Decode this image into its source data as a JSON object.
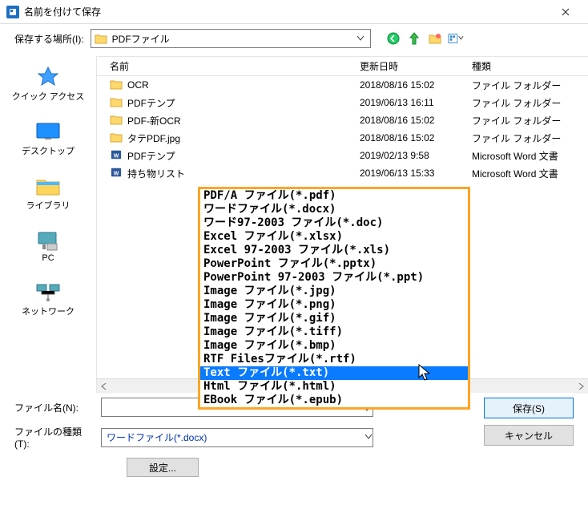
{
  "title": "名前を付けて保存",
  "location": {
    "label": "保存する場所(I):",
    "value": "PDFファイル"
  },
  "sidebar": {
    "items": [
      {
        "label": "クイック アクセス",
        "key": "quick-access"
      },
      {
        "label": "デスクトップ",
        "key": "desktop"
      },
      {
        "label": "ライブラリ",
        "key": "libraries"
      },
      {
        "label": "PC",
        "key": "pc"
      },
      {
        "label": "ネットワーク",
        "key": "network"
      }
    ]
  },
  "columns": {
    "name": "名前",
    "date": "更新日時",
    "type": "種類"
  },
  "files": [
    {
      "icon": "folder",
      "name": "OCR",
      "date": "2018/08/16 15:02",
      "type": "ファイル フォルダー"
    },
    {
      "icon": "folder",
      "name": "PDFテンプ",
      "date": "2019/06/13 16:11",
      "type": "ファイル フォルダー"
    },
    {
      "icon": "folder",
      "name": "PDF-新OCR",
      "date": "2018/08/16 15:02",
      "type": "ファイル フォルダー"
    },
    {
      "icon": "folder",
      "name": "タテPDF.jpg",
      "date": "2018/08/16 15:02",
      "type": "ファイル フォルダー"
    },
    {
      "icon": "word",
      "name": "PDFテンプ",
      "date": "2019/02/13 9:58",
      "type": "Microsoft Word 文書"
    },
    {
      "icon": "word",
      "name": "持ち物リスト",
      "date": "2019/06/13 15:33",
      "type": "Microsoft Word 文書"
    }
  ],
  "filetype_options": [
    "PDF/A ファイル(*.pdf)",
    "ワードファイル(*.docx)",
    "ワード97-2003 ファイル(*.doc)",
    "Excel ファイル(*.xlsx)",
    "Excel 97-2003 ファイル(*.xls)",
    "PowerPoint ファイル(*.pptx)",
    "PowerPoint 97-2003 ファイル(*.ppt)",
    "Image ファイル(*.jpg)",
    "Image ファイル(*.png)",
    "Image ファイル(*.gif)",
    "Image ファイル(*.tiff)",
    "Image ファイル(*.bmp)",
    "RTF Filesファイル(*.rtf)",
    "Text ファイル(*.txt)",
    "Html ファイル(*.html)",
    "EBook ファイル(*.epub)"
  ],
  "selected_option_index": 13,
  "form": {
    "filename_label": "ファイル名(N):",
    "filetype_label": "ファイルの種類(T):",
    "filetype_value": "ワードファイル(*.docx)",
    "filename_value": ""
  },
  "buttons": {
    "save": "保存(S)",
    "cancel": "キャンセル",
    "settings": "設定..."
  }
}
